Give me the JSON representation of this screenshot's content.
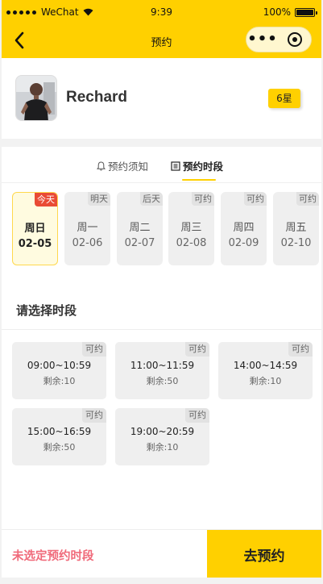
{
  "status_bar": {
    "carrier": "WeChat",
    "time": "9:39",
    "battery": "100%",
    "battery_level": 1.0
  },
  "nav": {
    "title": "预约",
    "more_icon": "ellipsis-icon",
    "close_icon": "target-icon",
    "back_icon": "chevron-left-icon"
  },
  "coach": {
    "name": "Rechard",
    "rating": "6星"
  },
  "tabs": [
    {
      "label": "预约须知",
      "icon": "bell-icon"
    },
    {
      "label": "预约时段",
      "icon": "list-icon"
    }
  ],
  "dates": [
    {
      "tag": "今天",
      "week": "周日",
      "date": "02-05",
      "selected": true
    },
    {
      "tag": "明天",
      "week": "周一",
      "date": "02-06",
      "selected": false
    },
    {
      "tag": "后天",
      "week": "周二",
      "date": "02-07",
      "selected": false
    },
    {
      "tag": "可约",
      "week": "周三",
      "date": "02-08",
      "selected": false
    },
    {
      "tag": "可约",
      "week": "周四",
      "date": "02-09",
      "selected": false
    },
    {
      "tag": "可约",
      "week": "周五",
      "date": "02-10",
      "selected": false
    }
  ],
  "section_title": "请选择时段",
  "slots": [
    {
      "tag": "可约",
      "range": "09:00~10:59",
      "remain": "剩余:10"
    },
    {
      "tag": "可约",
      "range": "11:00~11:59",
      "remain": "剩余:50"
    },
    {
      "tag": "可约",
      "range": "14:00~14:59",
      "remain": "剩余:10"
    },
    {
      "tag": "可约",
      "range": "15:00~16:59",
      "remain": "剩余:50"
    },
    {
      "tag": "可约",
      "range": "19:00~20:59",
      "remain": "剩余:10"
    }
  ],
  "footer": {
    "hint": "未选定预约时段",
    "submit_label": "去预约"
  },
  "colors": {
    "accent": "#ffd000",
    "today_tag": "#e94b35",
    "hint": "#f06a7a"
  }
}
